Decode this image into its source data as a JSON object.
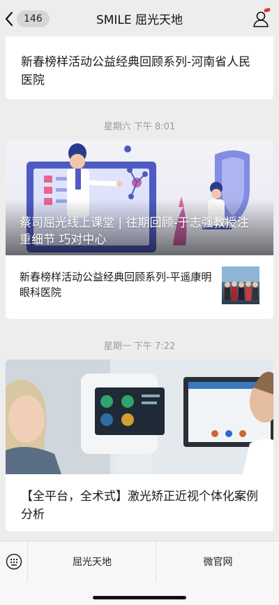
{
  "header": {
    "back_badge": "146",
    "title": "SMILE 屈光天地"
  },
  "feed": {
    "item1": {
      "title": "新春榜样活动公益经典回顾系列-河南省人民医院"
    },
    "group2": {
      "timestamp": "星期六 下午 8:01",
      "cover_caption": "蔡司屈光线上课堂 | 往期回顾-于志强教授注重细节 巧对中心",
      "sub_title": "新春榜样活动公益经典回顾系列-平遥康明眼科医院"
    },
    "group3": {
      "timestamp": "星期一 下午 7:22",
      "title": "【全平台，全术式】激光矫正近视个体化案例分析"
    }
  },
  "bottom_menu": {
    "items": [
      "屈光天地",
      "微官网"
    ]
  },
  "colors": {
    "background": "#ededed",
    "card": "#ffffff",
    "timestamp": "#9b9b9b",
    "accent_red": "#e02f2f"
  }
}
